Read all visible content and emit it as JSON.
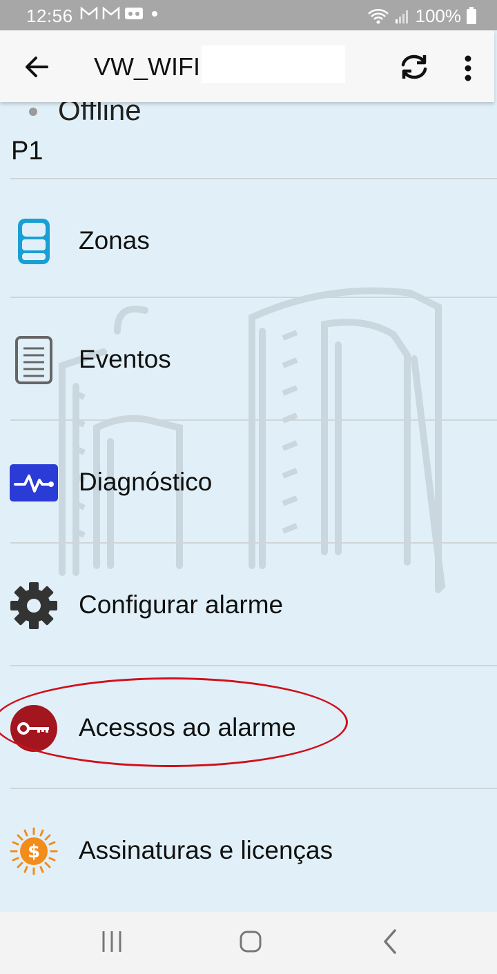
{
  "status_bar": {
    "time": "12:56",
    "notification_icons": [
      "gmail-icon",
      "gmail-icon",
      "voicemail-icon",
      "dot-icon"
    ],
    "battery_percent": "100%"
  },
  "app_bar": {
    "title": "VW_WIFI",
    "back_icon": "arrow-left-icon",
    "sync_icon": "sync-icon",
    "more_icon": "more-vert-icon"
  },
  "device": {
    "status": "Offline",
    "partition": "P1"
  },
  "menu": {
    "items": [
      {
        "label": "Zonas",
        "icon": "database-icon",
        "color": "#1a9fd4"
      },
      {
        "label": "Eventos",
        "icon": "document-list-icon",
        "color": "#666666"
      },
      {
        "label": "Diagnóstico",
        "icon": "pulse-icon",
        "color": "#2b3bd6"
      },
      {
        "label": "Configurar alarme",
        "icon": "gear-icon",
        "color": "#333333"
      },
      {
        "label": "Acessos ao alarme",
        "icon": "key-icon",
        "color": "#a3161f"
      },
      {
        "label": "Assinaturas e licenças",
        "icon": "sun-dollar-icon",
        "color": "#f28c1b"
      }
    ]
  },
  "annotation": {
    "color": "#d0101c"
  },
  "nav_bar": {
    "recents_icon": "recents-icon",
    "home_icon": "home-icon",
    "back_icon": "back-chevron-icon"
  }
}
